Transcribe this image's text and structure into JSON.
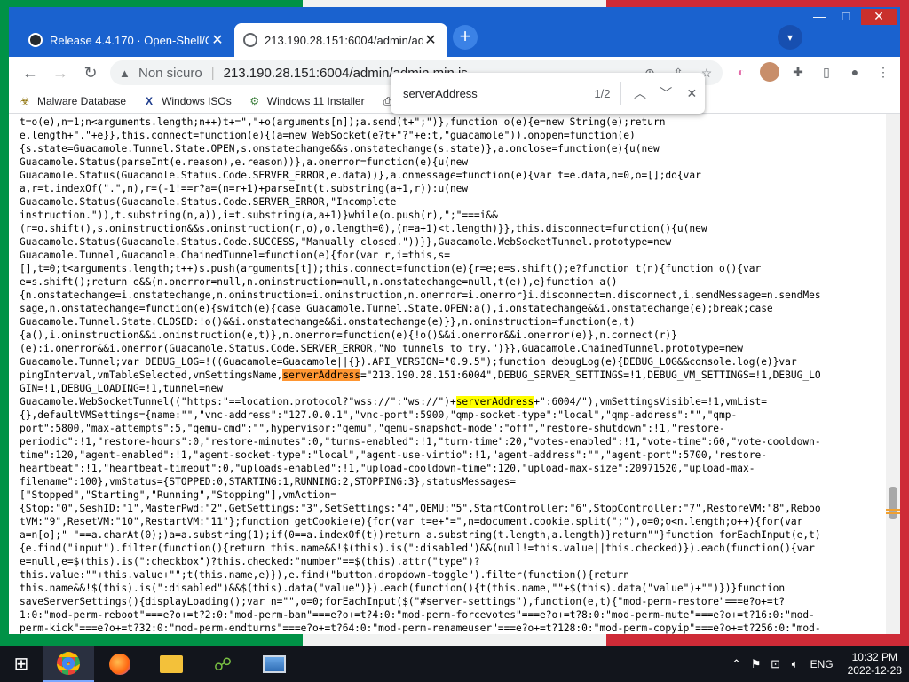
{
  "browser": {
    "tabs": [
      {
        "label": "Release 4.4.170 · Open-Shell/Ope",
        "active": false,
        "icon": "github-icon"
      },
      {
        "label": "213.190.28.151:6004/admin/admin",
        "active": true,
        "icon": "globe-icon"
      }
    ],
    "address": {
      "security": "Non sicuro",
      "url": "213.190.28.151:6004/admin/admin.min.js"
    },
    "bookmarks": [
      {
        "label": "Malware Database",
        "icon": "malware-icon"
      },
      {
        "label": "Windows ISOs",
        "icon": "windows-isos-icon"
      },
      {
        "label": "Windows 11 Installer",
        "icon": "installer-icon"
      }
    ],
    "find": {
      "query": "serverAddress",
      "count": "1/2"
    }
  },
  "code_lines": [
    "t=o(e),n=1;n<arguments.length;n++)t+=\",\"+o(arguments[n]);a.send(t+\";\")},function o(e){e=new String(e);return",
    "e.length+\".\"+e}},this.connect=function(e){(a=new WebSocket(e?t+\"?\"+e:t,\"guacamole\")).onopen=function(e)",
    "{s.state=Guacamole.Tunnel.State.OPEN,s.onstatechange&&s.onstatechange(s.state)},a.onclose=function(e){u(new",
    "Guacamole.Status(parseInt(e.reason),e.reason))},a.onerror=function(e){u(new",
    "Guacamole.Status(Guacamole.Status.Code.SERVER_ERROR,e.data))},a.onmessage=function(e){var t=e.data,n=0,o=[];do{var",
    "a,r=t.indexOf(\".\",n),r=(-1!==r?a=(n=r+1)+parseInt(t.substring(a+1,r)):u(new",
    "Guacamole.Status(Guacamole.Status.Code.SERVER_ERROR,\"Incomplete",
    "instruction.\")),t.substring(n,a)),i=t.substring(a,a+1)}while(o.push(r),\";\"===i&&",
    "(r=o.shift(),s.oninstruction&&s.oninstruction(r,o),o.length=0),(n=a+1)<t.length)}},this.disconnect=function(){u(new",
    "Guacamole.Status(Guacamole.Status.Code.SUCCESS,\"Manually closed.\"))}},Guacamole.WebSocketTunnel.prototype=new",
    "Guacamole.Tunnel,Guacamole.ChainedTunnel=function(e){for(var r,i=this,s=",
    "[],t=0;t<arguments.length;t++)s.push(arguments[t]);this.connect=function(e){r=e;e=s.shift();e?function t(n){function o(){var",
    "e=s.shift();return e&&(n.onerror=null,n.oninstruction=null,n.onstatechange=null,t(e)),e}function a()",
    "{n.onstatechange=i.onstatechange,n.oninstruction=i.oninstruction,n.onerror=i.onerror}i.disconnect=n.disconnect,i.sendMessage=n.sendMes",
    "sage,n.onstatechange=function(e){switch(e){case Guacamole.Tunnel.State.OPEN:a(),i.onstatechange&&i.onstatechange(e);break;case",
    "Guacamole.Tunnel.State.CLOSED:!o()&&i.onstatechange&&i.onstatechange(e)}},n.oninstruction=function(e,t)",
    "{a(),i.oninstruction&&i.oninstruction(e,t)},n.onerror=function(e){!o()&&i.onerror&&i.onerror(e)},n.connect(r)}",
    "(e):i.onerror&&i.onerror(Guacamole.Status.Code.SERVER_ERROR,\"No tunnels to try.\")}},Guacamole.ChainedTunnel.prototype=new",
    "Guacamole.Tunnel;var DEBUG_LOG=!((Guacamole=Guacamole||{}).API_VERSION=\"0.9.5\");function debugLog(e){DEBUG_LOG&&console.log(e)}var",
    "pingInterval,vmTableSelected,vmSettingsName,serverAddress=\"213.190.28.151:6004\",DEBUG_SERVER_SETTINGS=!1,DEBUG_VM_SETTINGS=!1,DEBUG_LO",
    "GIN=!1,DEBUG_LOADING=!1,tunnel=new",
    "Guacamole.WebSocketTunnel((\"https:\"==location.protocol?\"wss://\":\"ws://\")+serverAddress+\":6004/\"),vmSettingsVisible=!1,vmList=",
    "{},defaultVMSettings={name:\"\",\"vnc-address\":\"127.0.0.1\",\"vnc-port\":5900,\"qmp-socket-type\":\"local\",\"qmp-address\":\"\",\"qmp-",
    "port\":5800,\"max-attempts\":5,\"qemu-cmd\":\"\",hypervisor:\"qemu\",\"qemu-snapshot-mode\":\"off\",\"restore-shutdown\":!1,\"restore-",
    "periodic\":!1,\"restore-hours\":0,\"restore-minutes\":0,\"turns-enabled\":!1,\"turn-time\":20,\"votes-enabled\":!1,\"vote-time\":60,\"vote-cooldown-",
    "time\":120,\"agent-enabled\":!1,\"agent-socket-type\":\"local\",\"agent-use-virtio\":!1,\"agent-address\":\"\",\"agent-port\":5700,\"restore-",
    "heartbeat\":!1,\"heartbeat-timeout\":0,\"uploads-enabled\":!1,\"upload-cooldown-time\":120,\"upload-max-size\":20971520,\"upload-max-",
    "filename\":100},vmStatus={STOPPED:0,STARTING:1,RUNNING:2,STOPPING:3},statusMessages=",
    "[\"Stopped\",\"Starting\",\"Running\",\"Stopping\"],vmAction=",
    "{Stop:\"0\",SeshID:\"1\",MasterPwd:\"2\",GetSettings:\"3\",SetSettings:\"4\",QEMU:\"5\",StartController:\"6\",StopController:\"7\",RestoreVM:\"8\",Reboo",
    "tVM:\"9\",ResetVM:\"10\",RestartVM:\"11\"};function getCookie(e){for(var t=e+\"=\",n=document.cookie.split(\";\"),o=0;o<n.length;o++){for(var",
    "a=n[o];\" \"==a.charAt(0);)a=a.substring(1);if(0==a.indexOf(t))return a.substring(t.length,a.length)}return\"\"}function forEachInput(e,t)",
    "{e.find(\"input\").filter(function(){return this.name&&!$(this).is(\":disabled\")&&(null!=this.value||this.checked)}).each(function(){var",
    "e=null,e=$(this).is(\":checkbox\")?this.checked:\"number\"==$(this).attr(\"type\")?",
    "this.value:\"\"+this.value+\"\";t(this.name,e)}),e.find(\"button.dropdown-toggle\").filter(function(){return",
    "this.name&&!$(this).is(\":disabled\")&&$(this).data(\"value\")}).each(function(){t(this.name,\"\"+$(this).data(\"value\")+\"\")})}function",
    "saveServerSettings(){displayLoading();var n=\"\",o=0;forEachInput($(\"#server-settings\"),function(e,t){\"mod-perm-restore\"===e?o+=t?",
    "1:0:\"mod-perm-reboot\"===e?o+=t?2:0:\"mod-perm-ban\"===e?o+=t?4:0:\"mod-perm-forcevotes\"===e?o+=t?8:0:\"mod-perm-mute\"===e?o+=t?16:0:\"mod-",
    "perm-kick\"===e?o+=t?32:0:\"mod-perm-endturns\"===e?o+=t?64:0:\"mod-perm-renameuser\"===e?o+=t?128:0:\"mod-perm-copyip\"===e?o+=t?256:0:\"mod-"
  ],
  "taskbar": {
    "apps": [
      {
        "name": "chrome",
        "icon": "chrome-icon",
        "active": true
      },
      {
        "name": "firefox",
        "icon": "firefox-icon",
        "active": false
      },
      {
        "name": "file-explorer",
        "icon": "folder-icon",
        "active": false
      },
      {
        "name": "network",
        "icon": "network-icon",
        "active": false
      },
      {
        "name": "image-viewer",
        "icon": "picture-icon",
        "active": false
      }
    ],
    "lang": "ENG",
    "time": "10:32 PM",
    "date": "2022-12-28"
  },
  "colors": {
    "titlebar": "#1a62cf",
    "highlight": "#ffff00",
    "highlight_current": "#ff9632",
    "taskbar": "#12151c"
  }
}
